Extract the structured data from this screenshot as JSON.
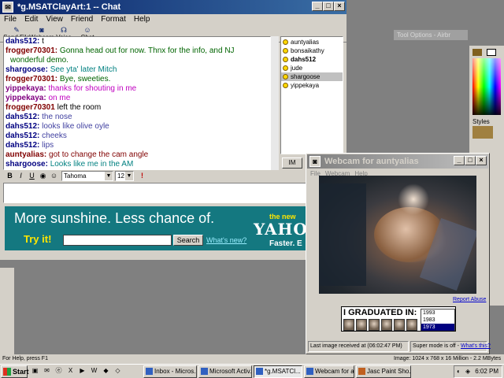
{
  "chat_window": {
    "title": "*g.MSATClayArt:1 -- Chat",
    "menu": [
      "File",
      "Edit",
      "View",
      "Friend",
      "Format",
      "Help"
    ],
    "toolbar": [
      "Send File",
      "Webcam",
      "Voice",
      "Chat"
    ],
    "messages": [
      {
        "sender": "dahs512:",
        "text": "t",
        "sender_color": "#000080",
        "text_color": "#000000"
      },
      {
        "sender": "frogger70301:",
        "text": "Gonna head out for now. Thnx for the info, and NJ",
        "sender_color": "#800000",
        "text_color": "#006400"
      },
      {
        "sender": "",
        "text": "wonderful demo.",
        "sender_color": "#800000",
        "text_color": "#006400"
      },
      {
        "sender": "shargoose:",
        "text": "See yta' later Mitch",
        "sender_color": "#000080",
        "text_color": "#008080"
      },
      {
        "sender": "frogger70301:",
        "text": "Bye, sweeties.",
        "sender_color": "#800000",
        "text_color": "#006400"
      },
      {
        "sender": "yippekaya:",
        "text": "thanks for shouting in me",
        "sender_color": "#800080",
        "text_color": "#c000c0"
      },
      {
        "sender": "yippekaya:",
        "text": "on me",
        "sender_color": "#800080",
        "text_color": "#c000c0"
      },
      {
        "sender": "frogger70301",
        "text": "left the room",
        "sender_color": "#800000",
        "text_color": "#000000"
      },
      {
        "sender": "dahs512:",
        "text": "the nose",
        "sender_color": "#000080",
        "text_color": "#4040a0"
      },
      {
        "sender": "dahs512:",
        "text": "looks like olive oyle",
        "sender_color": "#000080",
        "text_color": "#4040a0"
      },
      {
        "sender": "dahs512:",
        "text": "cheeks",
        "sender_color": "#000080",
        "text_color": "#4040a0"
      },
      {
        "sender": "dahs512:",
        "text": "lips",
        "sender_color": "#000080",
        "text_color": "#4040a0"
      },
      {
        "sender": "auntyalias:",
        "text": "got to change the cam angle",
        "sender_color": "#800000",
        "text_color": "#800000"
      },
      {
        "sender": "shargoose:",
        "text": "Looks like me in the AM",
        "sender_color": "#000080",
        "text_color": "#008080"
      }
    ],
    "users": [
      {
        "name": "auntyalias"
      },
      {
        "name": "bonsaikathy"
      },
      {
        "name": "dahs512"
      },
      {
        "name": "jude"
      },
      {
        "name": "shargoose"
      },
      {
        "name": "yippekaya"
      }
    ],
    "im_label": "IM",
    "font_name": "Tahoma",
    "font_size": "12"
  },
  "ad": {
    "headline": "More sunshine.  Less chance of.",
    "try_it": "Try it!",
    "search_label": "Search",
    "whats_new": "What's new?",
    "the_new": "the new",
    "logo": "YAHO",
    "faster": "Faster. E"
  },
  "paint": {
    "tool_options": "Tool Options - Airbr",
    "styles_label": "Styles"
  },
  "webcam": {
    "title": "Webcam for auntyalias",
    "menu": [
      "File",
      "Webcam",
      "Help"
    ],
    "report_abuse": "Report Abuse",
    "ad_text": "I GRADUATED IN:",
    "years": [
      "1993",
      "1983",
      "1973"
    ],
    "last_received": "Last image received at (06:02:47 PM)",
    "super_mode": "Super mode is off - ",
    "whats_this": "What's this?"
  },
  "statusbar": {
    "help": "For Help, press F1",
    "image_info": "Image:  1024 x 768 x 16 Million - 2.2 MBytes"
  },
  "taskbar": {
    "start": "Start",
    "tasks": [
      "Inbox - Micros...",
      "Microsoft Activ...",
      "*g.MSATCl...",
      "Webcam for a...",
      "Jasc Paint Sho..."
    ],
    "clock": "6:02 PM"
  }
}
